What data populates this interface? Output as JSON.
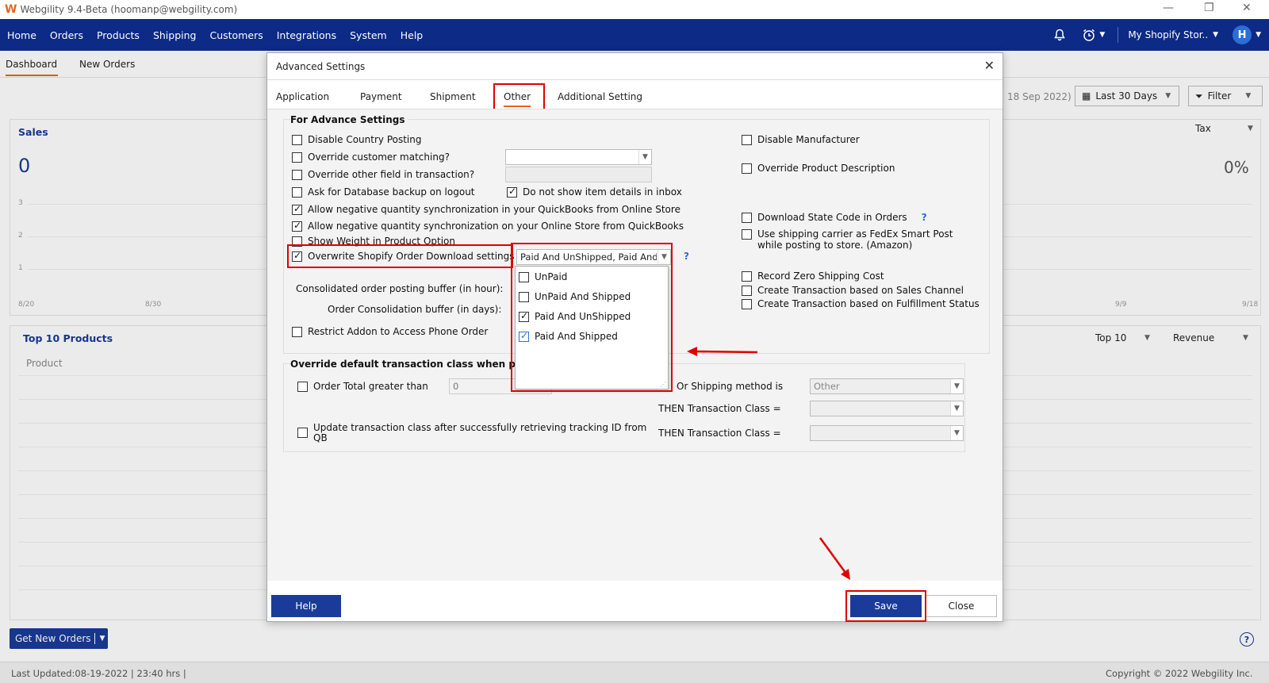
{
  "window": {
    "title": "Webgility 9.4-Beta (hoomanp@webgility.com)",
    "logo_glyph": "W",
    "controls": [
      "—",
      "❐",
      "✕"
    ]
  },
  "nav": {
    "items": [
      "Home",
      "Orders",
      "Products",
      "Shipping",
      "Customers",
      "Integrations",
      "System",
      "Help"
    ],
    "store": "My Shopify Stor..",
    "avatar": "H"
  },
  "subtabs": {
    "items": [
      "Dashboard",
      "New Orders"
    ],
    "active": "Dashboard"
  },
  "dashboard": {
    "date_hint": "18 Sep 2022)",
    "range": "Last 30 Days",
    "filter": "Filter",
    "sales": {
      "title": "Sales",
      "tax_label": "Tax",
      "value": "0",
      "pct": "0%",
      "y_ticks": [
        "3",
        "2",
        "1"
      ],
      "x_ticks": [
        "8/20",
        "8/30",
        "9/9",
        "9/18"
      ]
    },
    "top_products": {
      "title": "Top 10 Products",
      "col_product": "Product",
      "top_select": "Top 10",
      "metric_select": "Revenue"
    },
    "get_new_orders": "Get New Orders",
    "last_updated": "Last Updated:08-19-2022 | 23:40 hrs |",
    "copyright": "Copyright © 2022 Webgility Inc."
  },
  "modal": {
    "title": "Advanced Settings",
    "tabs": [
      "Application",
      "Payment",
      "Shipment",
      "Other",
      "Additional Setting"
    ],
    "active_tab": "Other",
    "advance": {
      "group_title": "For Advance Settings",
      "left": [
        {
          "label": "Disable Country Posting",
          "checked": false
        },
        {
          "label": "Override customer matching?",
          "checked": false
        },
        {
          "label": "Override other field in transaction?",
          "checked": false
        },
        {
          "label": "Ask for Database backup on logout",
          "checked": false
        },
        {
          "label": "Allow negative quantity synchronization in your QuickBooks from  Online Store",
          "checked": true
        },
        {
          "label": "Allow negative quantity synchronization on your Online Store from QuickBooks",
          "checked": true
        },
        {
          "label": "Show Weight in Product Option",
          "checked": false
        },
        {
          "label": "Overwrite Shopify Order Download settings",
          "checked": true
        }
      ],
      "inbox_option": {
        "label": "Do not show item details in inbox",
        "checked": true
      },
      "order_download_value": "Paid And UnShipped, Paid And Shipped",
      "dropdown_options": [
        {
          "label": "UnPaid",
          "checked": false
        },
        {
          "label": "UnPaid And Shipped",
          "checked": false
        },
        {
          "label": "Paid And UnShipped",
          "checked": true
        },
        {
          "label": "Paid And Shipped",
          "checked": true
        }
      ],
      "consolidated_label": "Consolidated order posting buffer (in hour):",
      "consolidation_days_label": "Order Consolidation buffer (in days):",
      "restrict_addon": {
        "label": "Restrict Addon to Access Phone Order",
        "checked": false
      },
      "right": [
        {
          "label": "Disable Manufacturer",
          "checked": false
        },
        {
          "label": "Override Product Description",
          "checked": false
        },
        {
          "label": "Download State Code in Orders",
          "checked": false
        },
        {
          "label": "Use shipping carrier as FedEx Smart Post",
          "checked": false
        },
        {
          "label": "Record Zero Shipping Cost",
          "checked": false
        },
        {
          "label": "Create Transaction based on Sales Channel",
          "checked": false
        },
        {
          "label": "Create Transaction based on Fulfillment Status",
          "checked": false
        }
      ],
      "smart_post_line2": "while posting to store. (Amazon)",
      "help_q": "?"
    },
    "override": {
      "group_title": "Override default transaction class when p",
      "order_total": {
        "label": "Order Total greater than",
        "checked": false
      },
      "order_total_value": "0",
      "shipping_method_label": "Or Shipping method is",
      "shipping_method_value": "Other",
      "then_class_label": "THEN Transaction Class =",
      "update_class": {
        "label": "Update transaction class after successfully retrieving tracking ID from",
        "label2": "QB",
        "checked": false
      }
    },
    "buttons": {
      "help": "Help",
      "save": "Save",
      "close": "Close"
    }
  },
  "colors": {
    "nav_bg": "#0c2a86",
    "accent": "#e8641b",
    "button_blue": "#1a3b9a",
    "highlight_red": "#e00000"
  }
}
